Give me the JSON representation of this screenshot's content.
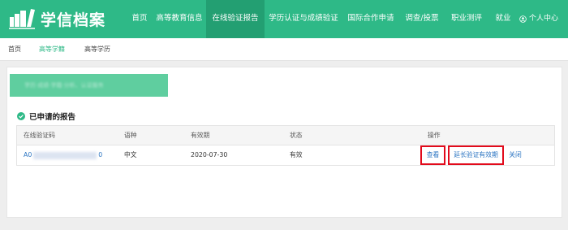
{
  "brand": {
    "name": "学信档案"
  },
  "nav": {
    "items": [
      "首页",
      "高等教育信息",
      "在线验证报告",
      "学历认证与成绩验证",
      "国际合作申请",
      "调查/投票",
      "职业测评",
      "就业"
    ],
    "active_index": 2,
    "user_label": "个人中心"
  },
  "breadcrumb": {
    "items": [
      "首页",
      "高等学籍",
      "高等学历"
    ],
    "active_index": 1
  },
  "banner": {
    "text": "学历·成绩·学籍·分析、认证服务"
  },
  "section": {
    "title": "已申请的报告"
  },
  "table": {
    "headers": [
      "在线验证码",
      "语种",
      "有效期",
      "状态",
      "操作"
    ],
    "rows": [
      {
        "code_start": "A0",
        "code_end": "0",
        "language": "中文",
        "expiry": "2020-07-30",
        "status": "有效",
        "actions": [
          "查看",
          "延长验证有效期",
          "关闭"
        ]
      }
    ]
  },
  "colors": {
    "brand_green": "#2eb987",
    "nav_active": "#239f72",
    "link_blue": "#2b74c2",
    "highlight_red": "#e20a1b"
  }
}
